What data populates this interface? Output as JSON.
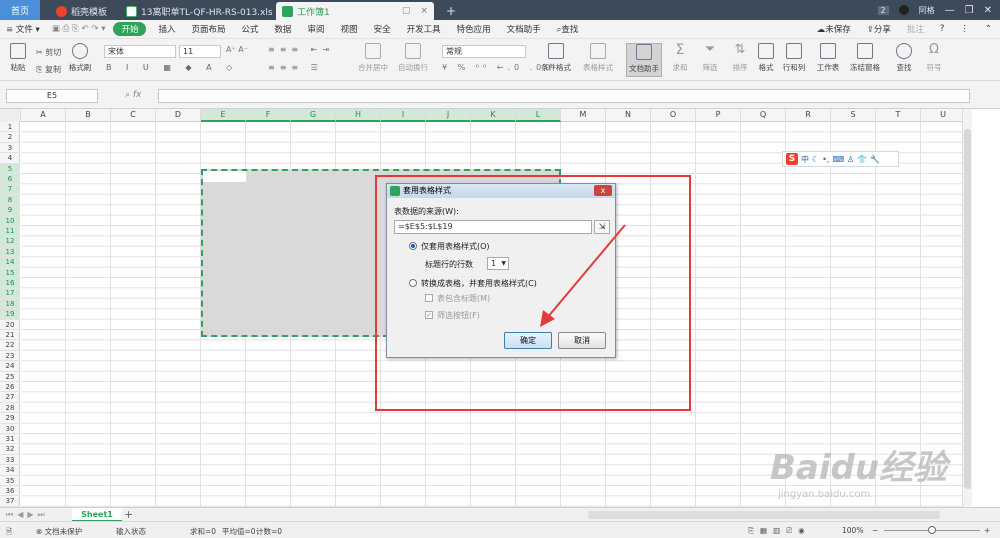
{
  "titlebar": {
    "home_tab": "首页",
    "tabs": [
      {
        "label": "稻壳模板",
        "icon": "docer-icon"
      },
      {
        "label": "13离职单TL-QF-HR-RS-013.xls",
        "icon": "sheet-icon"
      },
      {
        "label": "工作簿1",
        "icon": "sheet-icon"
      }
    ],
    "add_tab": "+",
    "page_count": "2",
    "user": "阿格"
  },
  "menubar": {
    "file": "文件",
    "start": "开始",
    "items": [
      "插入",
      "页面布局",
      "公式",
      "数据",
      "审阅",
      "视图",
      "安全",
      "开发工具",
      "特色应用",
      "文档助手"
    ],
    "search": "查找",
    "unsaved": "未保存",
    "share": "分享",
    "comment": "批注"
  },
  "ribbon": {
    "paste": "粘贴",
    "cut": "剪切",
    "copy": "复制",
    "format_painter": "格式刷",
    "font_name": "宋体",
    "font_size": "11",
    "merge_center": "合并居中",
    "wrap": "自动换行",
    "number_format": "常规",
    "cond_format": "条件格式",
    "table_style": "表格样式",
    "doc_helper": "文档助手",
    "sum": "求和",
    "filter": "筛选",
    "sort": "排序",
    "format": "格式",
    "row_col": "行和列",
    "worksheet": "工作表",
    "freeze": "冻结窗格",
    "find": "查找",
    "symbol": "符号"
  },
  "formula_bar": {
    "name_box": "E5",
    "fx": "fx",
    "value": ""
  },
  "grid": {
    "columns": [
      "A",
      "B",
      "C",
      "D",
      "E",
      "F",
      "G",
      "H",
      "I",
      "J",
      "K",
      "L",
      "M",
      "N",
      "O",
      "P",
      "Q",
      "R",
      "S",
      "T",
      "U"
    ],
    "selected_columns": [
      "E",
      "F",
      "G",
      "H",
      "I",
      "J",
      "K",
      "L"
    ],
    "rows": [
      "1",
      "2",
      "3",
      "4",
      "5",
      "6",
      "7",
      "8",
      "9",
      "10",
      "11",
      "12",
      "13",
      "14",
      "15",
      "16",
      "17",
      "18",
      "19",
      "20",
      "21",
      "22",
      "23",
      "24",
      "25",
      "26",
      "27",
      "28",
      "29",
      "30",
      "31",
      "32",
      "33",
      "34",
      "35",
      "36",
      "37"
    ],
    "selected_rows": [
      "5",
      "6",
      "7",
      "8",
      "9",
      "10",
      "11",
      "12",
      "13",
      "14",
      "15",
      "16",
      "17",
      "18",
      "19"
    ]
  },
  "ime": {
    "logo": "S",
    "mode": "中"
  },
  "dialog": {
    "title": "套用表格样式",
    "source_label": "表数据的来源(W):",
    "source_value": "=$E$5:$L$19",
    "option1": "仅套用表格样式(O)",
    "header_rows_label": "标题行的行数",
    "header_rows_value": "1",
    "option2": "转换成表格，并套用表格样式(C)",
    "check1": "表包含标题(M)",
    "check2": "筛选按钮(F)",
    "ok": "确定",
    "cancel": "取消",
    "close": "x"
  },
  "sheets": {
    "tabs": [
      "Sheet1"
    ],
    "add": "+"
  },
  "status": {
    "protect": "文档未保护",
    "mode": "输入状态",
    "sum": "求和=0",
    "avg": "平均值=0",
    "count": "计数=0",
    "zoom": "100%"
  },
  "watermark": {
    "brand": "Baidu经验",
    "url": "jingyan.baidu.com"
  },
  "colors": {
    "accent": "#2fa35b",
    "annotation": "#e33a3a",
    "home_tab": "#4a8fd8",
    "titlebar": "#3d4a5a"
  }
}
